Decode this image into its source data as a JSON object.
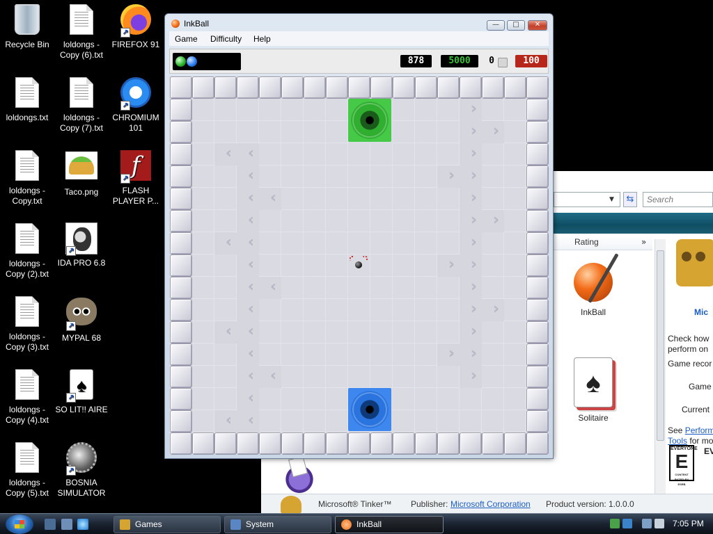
{
  "desktop": {
    "icons": [
      {
        "label": "Recycle Bin"
      },
      {
        "label": "loldongs - Copy (6).txt"
      },
      {
        "label": "FIREFOX 91"
      },
      {
        "label": "loldongs.txt"
      },
      {
        "label": "loldongs - Copy (7).txt"
      },
      {
        "label": "CHROMIUM 101"
      },
      {
        "label": "loldongs - Copy.txt"
      },
      {
        "label": "Taco.png"
      },
      {
        "label": "FLASH PLAYER P..."
      },
      {
        "label": "loldongs - Copy (2).txt"
      },
      {
        "label": "IDA PRO 6.8"
      },
      {
        "label": "loldongs - Copy (3).txt"
      },
      {
        "label": "MYPAL 68"
      },
      {
        "label": "loldongs - Copy (4).txt"
      },
      {
        "label": "SO LIT!! AIRE"
      },
      {
        "label": "loldongs - Copy (5).txt"
      },
      {
        "label": "BOSNIA SIMULATOR"
      }
    ]
  },
  "inkball": {
    "title": "InkBall",
    "menu": [
      "Game",
      "Difficulty",
      "Help"
    ],
    "buttons": {
      "minimize": "—",
      "maximize": "□",
      "close": "✕"
    },
    "time": "878",
    "score": "5000",
    "counter_small": "0",
    "counter_red": "100",
    "balls_in_tray": [
      "green",
      "blue"
    ]
  },
  "explorer": {
    "search_placeholder": "Search",
    "column_rating": "Rating",
    "column_more": "»",
    "games": [
      {
        "label": "InkBall"
      },
      {
        "label": "Solitaire"
      }
    ],
    "details": {
      "title_partial": "Mic",
      "check_line1": "Check how",
      "check_line2": "perform on",
      "game_rec": "Game recor",
      "game": "Game",
      "current": "Current",
      "see": "See",
      "perf_link": "Perform",
      "tools_link": "Tools",
      "for_more": "for mo",
      "esrb_letter": "E",
      "esrb_top": "EVERYONE",
      "esrb_bottom": "CONTENT RATED BY ESRB",
      "ev_partial": "EV"
    },
    "tinker": {
      "name": "Microsoft® Tinker™",
      "publisher_label": "Publisher:",
      "publisher": "Microsoft Corporation",
      "version_label": "Product version:",
      "version": "1.0.0.0"
    }
  },
  "taskbar": {
    "tasks": [
      {
        "label": "Games"
      },
      {
        "label": "System"
      },
      {
        "label": "InkBall"
      }
    ],
    "clock": "7:05 PM"
  },
  "colors": {
    "accent_explorer_bar": "#0f4e63",
    "score_green": "#35c235",
    "counter_red": "#b6261a",
    "hole_green": "#2fae2f",
    "hole_blue": "#2a74e0"
  }
}
